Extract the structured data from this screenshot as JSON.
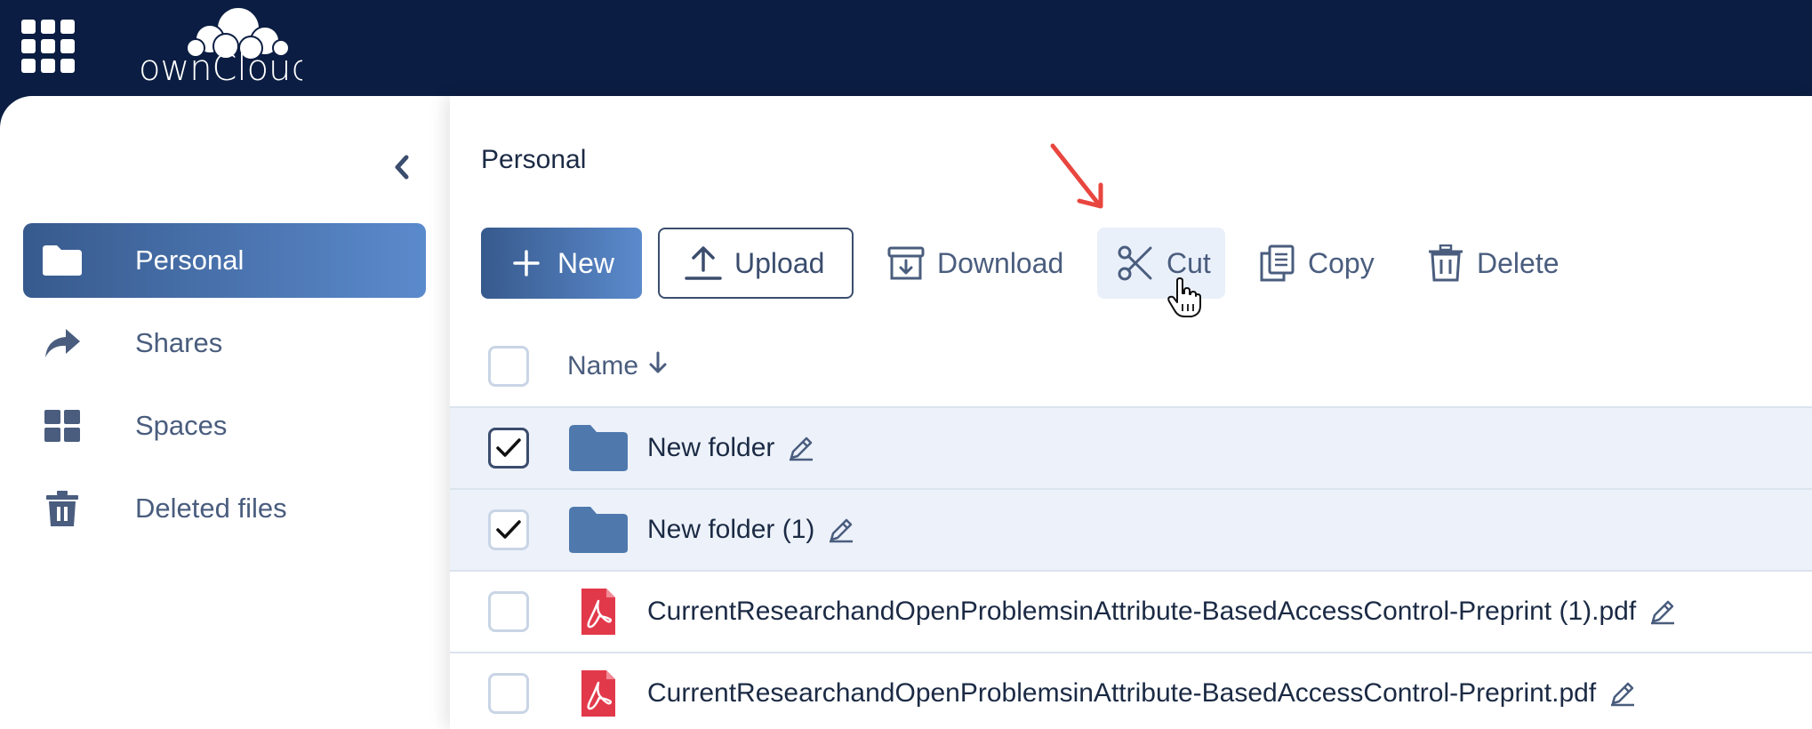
{
  "app": {
    "logo_text": "ownCloud"
  },
  "sidebar": {
    "items": [
      {
        "label": "Personal",
        "icon": "folder-icon",
        "active": true
      },
      {
        "label": "Shares",
        "icon": "share-arrow-icon",
        "active": false
      },
      {
        "label": "Spaces",
        "icon": "grid-icon",
        "active": false
      },
      {
        "label": "Deleted files",
        "icon": "trash-icon",
        "active": false
      }
    ]
  },
  "main": {
    "title": "Personal",
    "toolbar": {
      "new_label": "New",
      "upload_label": "Upload",
      "download_label": "Download",
      "cut_label": "Cut",
      "copy_label": "Copy",
      "delete_label": "Delete"
    },
    "table": {
      "name_header": "Name",
      "rows": [
        {
          "name": "New folder",
          "type": "folder",
          "selected": true
        },
        {
          "name": "New folder (1)",
          "type": "folder",
          "selected": true
        },
        {
          "name": "CurrentResearchandOpenProblemsinAttribute-BasedAccessControl-Preprint (1).pdf",
          "type": "pdf",
          "selected": false
        },
        {
          "name": "CurrentResearchandOpenProblemsinAttribute-BasedAccessControl-Preprint.pdf",
          "type": "pdf",
          "selected": false
        }
      ]
    }
  },
  "colors": {
    "topbar": "#0b1d42",
    "accent_start": "#375a8d",
    "accent_end": "#5b8acc",
    "folder": "#4f79ad",
    "pdf": "#e2394a",
    "selected_row": "#edf2fa",
    "annotation_arrow": "#e8463f"
  }
}
